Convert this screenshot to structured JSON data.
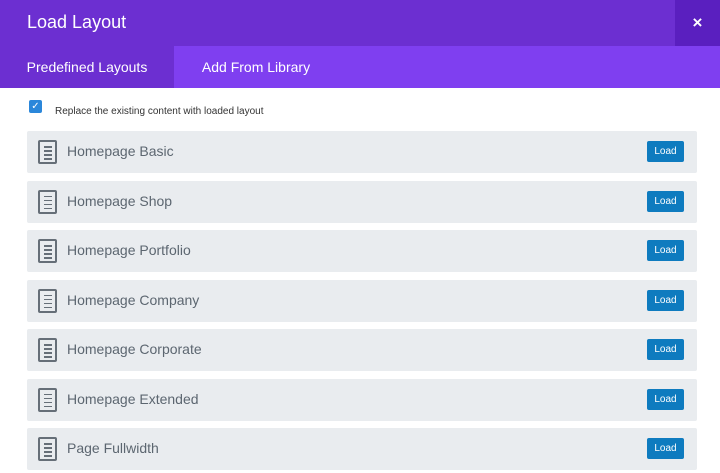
{
  "header": {
    "title": "Load Layout",
    "close_label": "×"
  },
  "tabs": [
    {
      "label": "Predefined Layouts",
      "active": true
    },
    {
      "label": "Add From Library",
      "active": false
    }
  ],
  "replace_option": {
    "label": "Replace the existing content with loaded layout",
    "checked": true,
    "check_glyph": "✓"
  },
  "layouts": [
    {
      "name": "Homepage Basic",
      "button": "Load"
    },
    {
      "name": "Homepage Shop",
      "button": "Load"
    },
    {
      "name": "Homepage Portfolio",
      "button": "Load"
    },
    {
      "name": "Homepage Company",
      "button": "Load"
    },
    {
      "name": "Homepage Corporate",
      "button": "Load"
    },
    {
      "name": "Homepage Extended",
      "button": "Load"
    },
    {
      "name": "Page Fullwidth",
      "button": "Load"
    }
  ],
  "colors": {
    "title_bar": "#6c2fd1",
    "tab_bar": "#7f3ff0",
    "load_button": "#0e7bbf",
    "checkbox": "#2b87da",
    "row_background": "#e9ecef"
  },
  "icons": {
    "close": "close-icon",
    "layout_item": "document-icon",
    "checkbox": "check-icon"
  }
}
